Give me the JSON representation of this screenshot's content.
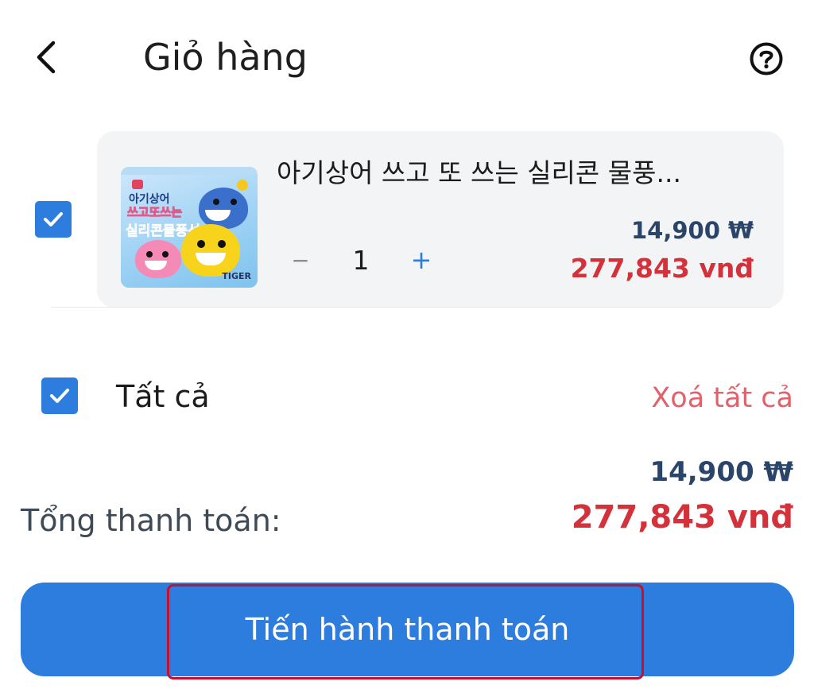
{
  "header": {
    "title": "Giỏ hàng",
    "back_icon": "chevron-left-icon",
    "help_icon": "question-circle-icon"
  },
  "cart": {
    "items": [
      {
        "name": "아기상어 쓰고 또 쓰는 실리콘 물풍...",
        "quantity": "1",
        "minus_label": "−",
        "plus_label": "+",
        "price_krw": "14,900 ₩",
        "price_vnd": "277,843 vnđ",
        "selected": true,
        "thumbnail": {
          "line1": "아기상어",
          "line2": "쓰고또쓰는",
          "line3": "실리콘물풍선",
          "brand": "TIGER"
        }
      }
    ]
  },
  "select_all": {
    "label": "Tất cả",
    "checked": true
  },
  "delete_all": {
    "label": "Xoá tất cả"
  },
  "summary": {
    "total_label": "Tổng thanh toán:",
    "total_krw": "14,900 ₩",
    "total_vnd": "277,843 vnđ"
  },
  "checkout": {
    "label": "Tiến hành thanh toán"
  },
  "colors": {
    "accent": "#2d7ddf",
    "price_red": "#d3323a",
    "price_navy": "#2b4469",
    "delete_text": "#e0636b",
    "highlight_outline": "#c8102e"
  }
}
